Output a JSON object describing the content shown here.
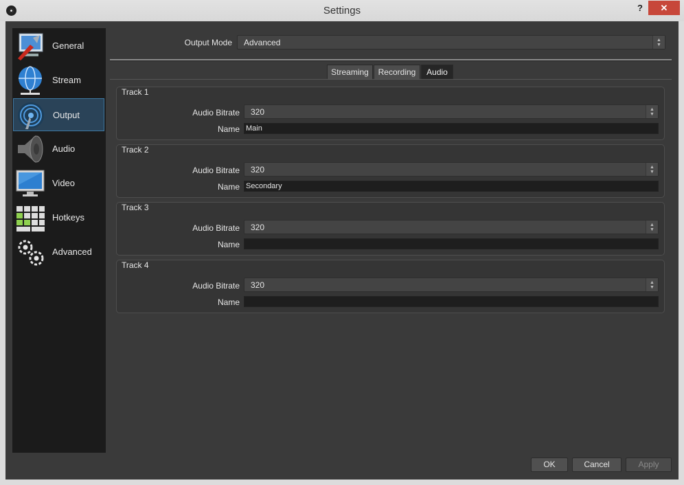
{
  "window": {
    "title": "Settings",
    "help_label": "?",
    "close_label": "✕"
  },
  "sidebar": {
    "items": [
      {
        "label": "General",
        "icon": "general-icon"
      },
      {
        "label": "Stream",
        "icon": "stream-globe-icon"
      },
      {
        "label": "Output",
        "icon": "output-broadcast-icon"
      },
      {
        "label": "Audio",
        "icon": "speaker-icon"
      },
      {
        "label": "Video",
        "icon": "monitor-icon"
      },
      {
        "label": "Hotkeys",
        "icon": "keyboard-icon"
      },
      {
        "label": "Advanced",
        "icon": "gears-icon"
      }
    ],
    "selected": "Output"
  },
  "output_mode": {
    "label": "Output Mode",
    "value": "Advanced"
  },
  "tabs": [
    {
      "label": "Streaming"
    },
    {
      "label": "Recording"
    },
    {
      "label": "Audio"
    }
  ],
  "active_tab": "Audio",
  "tracks": [
    {
      "title": "Track 1",
      "bitrate_label": "Audio Bitrate",
      "bitrate": "320",
      "name_label": "Name",
      "name": "Main"
    },
    {
      "title": "Track 2",
      "bitrate_label": "Audio Bitrate",
      "bitrate": "320",
      "name_label": "Name",
      "name": "Secondary"
    },
    {
      "title": "Track 3",
      "bitrate_label": "Audio Bitrate",
      "bitrate": "320",
      "name_label": "Name",
      "name": ""
    },
    {
      "title": "Track 4",
      "bitrate_label": "Audio Bitrate",
      "bitrate": "320",
      "name_label": "Name",
      "name": ""
    }
  ],
  "buttons": {
    "ok": "OK",
    "cancel": "Cancel",
    "apply": "Apply"
  },
  "colors": {
    "panel_bg": "#3a3a3a",
    "sidebar_bg": "#1b1b1b",
    "selection": "#2a4358",
    "selection_border": "#3e79a3",
    "close_red": "#c7473a"
  }
}
